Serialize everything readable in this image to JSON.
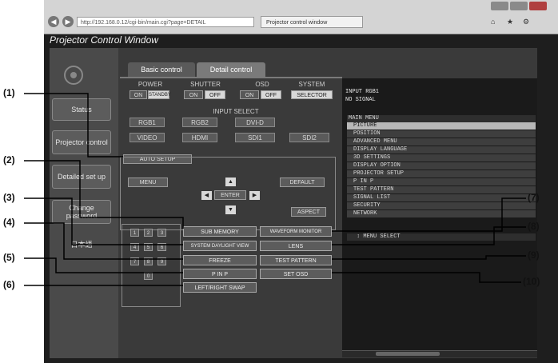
{
  "browser": {
    "address": "http://192.168.0.12/cgi-bin/main.cgi?page=DETAIL",
    "tab_title": "Projector control window",
    "colors": {
      "frame": "#1e1e1e",
      "content": "#3a3a3a"
    }
  },
  "page_title": "Projector Control Window",
  "sidebar": {
    "items": [
      {
        "label": "Status"
      },
      {
        "label": "Projector control"
      },
      {
        "label": "Detailed set up"
      },
      {
        "label": "Change password"
      },
      {
        "label": "日本語"
      }
    ]
  },
  "tabs": [
    {
      "label": "Basic control"
    },
    {
      "label": "Detail control"
    }
  ],
  "groups": {
    "power": {
      "label": "POWER",
      "on": "ON",
      "off": "STANDBY"
    },
    "shutter": {
      "label": "SHUTTER",
      "on": "ON",
      "off": "OFF"
    },
    "osd": {
      "label": "OSD",
      "on": "ON",
      "off": "OFF"
    },
    "system": {
      "label": "SYSTEM",
      "value": "SELECTOR"
    }
  },
  "input_select": {
    "label": "INPUT SELECT",
    "row1": [
      "RGB1",
      "RGB2",
      "DVI-D"
    ],
    "row2": [
      "VIDEO",
      "HDMI",
      "SDI1",
      "SDI2"
    ]
  },
  "controls": {
    "auto_setup": "AUTO SETUP",
    "menu": "MENU",
    "default": "DEFAULT",
    "enter": "ENTER",
    "aspect": "ASPECT",
    "up": "▲",
    "down": "▼",
    "left": "◀",
    "right": "▶"
  },
  "numpad": [
    "1",
    "2",
    "3",
    "4",
    "5",
    "6",
    "7",
    "8",
    "9",
    "0"
  ],
  "function_buttons": {
    "sub_memory": "SUB MEMORY",
    "system_daylight": "SYSTEM DAYLIGHT VIEW",
    "freeze": "FREEZE",
    "p_in_p": "P IN P",
    "left_right_swap": "LEFT/RIGHT SWAP",
    "waveform": "WAVEFORM MONITOR",
    "lens": "LENS",
    "test_pattern": "TEST PATTERN",
    "set_osd": "SET OSD"
  },
  "menu_display": {
    "status_line1": "INPUT RGB1",
    "status_line2": "NO SIGNAL",
    "header": "MAIN MENU",
    "items": [
      "PICTURE",
      "POSITION",
      "ADVANCED MENU",
      "DISPLAY LANGUAGE",
      "3D SETTINGS",
      "DISPLAY OPTION",
      "PROJECTOR SETUP",
      "P IN P",
      "TEST PATTERN",
      "SIGNAL LIST",
      "SECURITY",
      "NETWORK"
    ],
    "footer": "↕  MENU SELECT"
  },
  "callouts": {
    "c1": "(1)",
    "c2": "(2)",
    "c3": "(3)",
    "c4": "(4)",
    "c5": "(5)",
    "c6": "(6)",
    "c7": "(7)",
    "c8": "(8)",
    "c9": "(9)",
    "c10": "(10)"
  }
}
